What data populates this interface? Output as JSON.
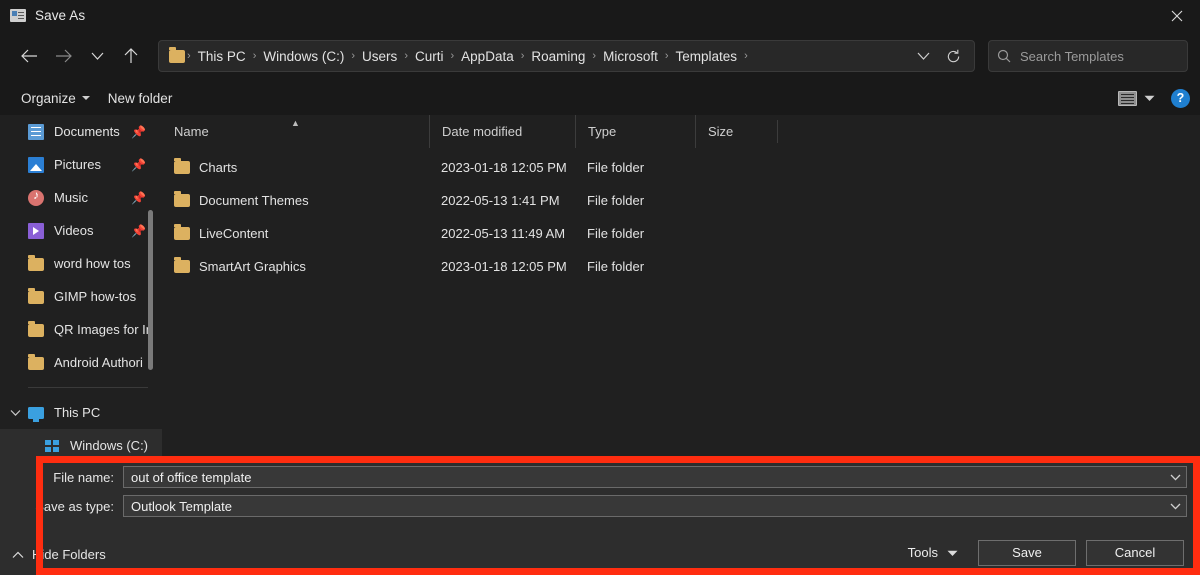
{
  "window": {
    "title": "Save As",
    "title_icon": "save-as-icon",
    "close_icon": "close-icon"
  },
  "nav": {
    "back_icon": "arrow-left-icon",
    "forward_icon": "arrow-right-icon",
    "recent_icon": "chevron-down-icon",
    "up_icon": "arrow-up-icon",
    "address_dropdown_icon": "chevron-down-icon",
    "refresh_icon": "refresh-icon",
    "folder_icon": "folder-icon",
    "separator": "›",
    "breadcrumbs": [
      "This PC",
      "Windows (C:)",
      "Users",
      "Curti",
      "AppData",
      "Roaming",
      "Microsoft",
      "Templates"
    ]
  },
  "search": {
    "placeholder": "Search Templates",
    "value": "",
    "icon": "search-icon"
  },
  "commandbar": {
    "organize_label": "Organize",
    "new_folder_label": "New folder",
    "view_icon": "view-layout-icon",
    "view_dropdown_icon": "chevron-down-icon",
    "help_icon": "help-icon",
    "help_label": "?"
  },
  "sidebar": {
    "items": [
      {
        "label": "Documents",
        "icon": "documents-icon",
        "pinned": true,
        "pin_icon": "pin-icon"
      },
      {
        "label": "Pictures",
        "icon": "pictures-icon",
        "pinned": true,
        "pin_icon": "pin-icon"
      },
      {
        "label": "Music",
        "icon": "music-icon",
        "pinned": true,
        "pin_icon": "pin-icon"
      },
      {
        "label": "Videos",
        "icon": "videos-icon",
        "pinned": true,
        "pin_icon": "pin-icon"
      },
      {
        "label": "word how tos",
        "icon": "folder-icon",
        "pinned": false
      },
      {
        "label": "GIMP how-tos",
        "icon": "folder-icon",
        "pinned": false
      },
      {
        "label": "QR Images for In",
        "icon": "folder-icon",
        "pinned": false
      },
      {
        "label": "Android Authori",
        "icon": "folder-icon",
        "pinned": false
      }
    ],
    "tree": [
      {
        "label": "This PC",
        "icon": "this-pc-icon",
        "expand_icon": "chevron-down-icon",
        "selected": false
      },
      {
        "label": "Windows (C:)",
        "icon": "drive-icon",
        "expand_icon": "chevron-right-icon",
        "selected": true
      }
    ],
    "scrollbar": "sidebar-scrollbar"
  },
  "filelist": {
    "columns": [
      {
        "label": "Name",
        "sorted": "asc",
        "sort_icon": "caret-up-icon"
      },
      {
        "label": "Date modified"
      },
      {
        "label": "Type"
      },
      {
        "label": "Size"
      }
    ],
    "rows": [
      {
        "name": "Charts",
        "date": "2023-01-18 12:05 PM",
        "type": "File folder",
        "size": "",
        "icon": "folder-icon"
      },
      {
        "name": "Document Themes",
        "date": "2022-05-13 1:41 PM",
        "type": "File folder",
        "size": "",
        "icon": "folder-icon"
      },
      {
        "name": "LiveContent",
        "date": "2022-05-13 11:49 AM",
        "type": "File folder",
        "size": "",
        "icon": "folder-icon"
      },
      {
        "name": "SmartArt Graphics",
        "date": "2023-01-18 12:05 PM",
        "type": "File folder",
        "size": "",
        "icon": "folder-icon"
      }
    ]
  },
  "savepane": {
    "filename_label": "File name:",
    "filename_value": "out of office template",
    "filename_dropdown_icon": "chevron-down-icon",
    "filetype_label": "Save as type:",
    "filetype_value": "Outlook Template",
    "filetype_dropdown_icon": "chevron-down-icon",
    "hide_folders_label": "Hide Folders",
    "hide_folders_icon": "chevron-up-icon",
    "tools_label": "Tools",
    "tools_icon": "chevron-down-icon",
    "save_label": "Save",
    "cancel_label": "Cancel"
  },
  "annotation": {
    "highlight_color": "#ff2d10",
    "name": "save-pane-highlight"
  }
}
